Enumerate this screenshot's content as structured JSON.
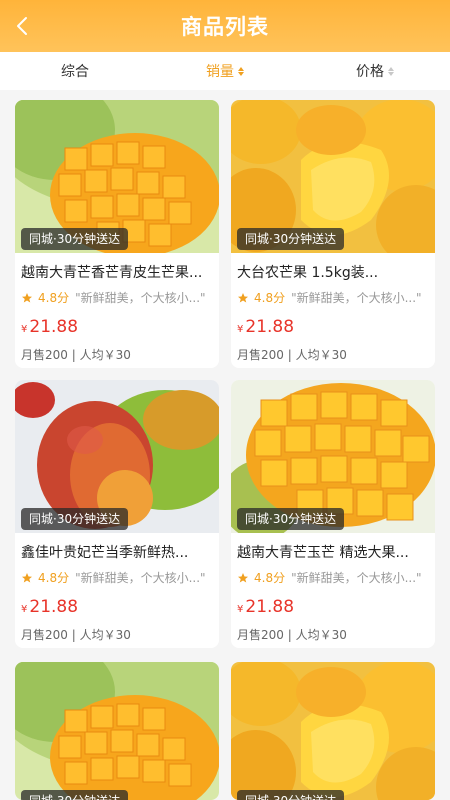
{
  "header": {
    "title": "商品列表",
    "back_icon": "chevron-left-icon"
  },
  "sortbar": {
    "items": [
      {
        "label": "综合",
        "active": false
      },
      {
        "label": "销量",
        "active": true
      },
      {
        "label": "价格",
        "active": false
      }
    ]
  },
  "products": [
    {
      "name": "越南大青芒香芒青皮生芒果...",
      "badge": "同城·30分钟送达",
      "score": "4.8分",
      "review": "\"新鲜甜美，个大核小...\"",
      "currency": "¥",
      "price": "21.88",
      "sold": "月售200",
      "avg": "人均￥30",
      "img": "cut-mango"
    },
    {
      "name": "大台农芒果 1.5kg装...",
      "badge": "同城·30分钟送达",
      "score": "4.8分",
      "review": "\"新鲜甜美，个大核小...\"",
      "currency": "¥",
      "price": "21.88",
      "sold": "月售200",
      "avg": "人均￥30",
      "img": "yellow-mangoes"
    },
    {
      "name": "鑫佳叶贵妃芒当季新鲜热...",
      "badge": "同城·30分钟送达",
      "score": "4.8分",
      "review": "\"新鲜甜美，个大核小...\"",
      "currency": "¥",
      "price": "21.88",
      "sold": "月售200",
      "avg": "人均￥30",
      "img": "red-mango"
    },
    {
      "name": "越南大青芒玉芒 精选大果...",
      "badge": "同城·30分钟送达",
      "score": "4.8分",
      "review": "\"新鲜甜美，个大核小...\"",
      "currency": "¥",
      "price": "21.88",
      "sold": "月售200",
      "avg": "人均￥30",
      "img": "cubed-mango"
    },
    {
      "name": "",
      "badge": "同城·30分钟送达",
      "score": "",
      "review": "",
      "currency": "",
      "price": "",
      "sold": "",
      "avg": "",
      "img": "cut-mango"
    },
    {
      "name": "",
      "badge": "同城·30分钟送达",
      "score": "",
      "review": "",
      "currency": "",
      "price": "",
      "sold": "",
      "avg": "",
      "img": "yellow-mangoes"
    }
  ],
  "colors": {
    "accent": "#f0a020",
    "price": "#e8342a",
    "header": "#ffb43a"
  }
}
